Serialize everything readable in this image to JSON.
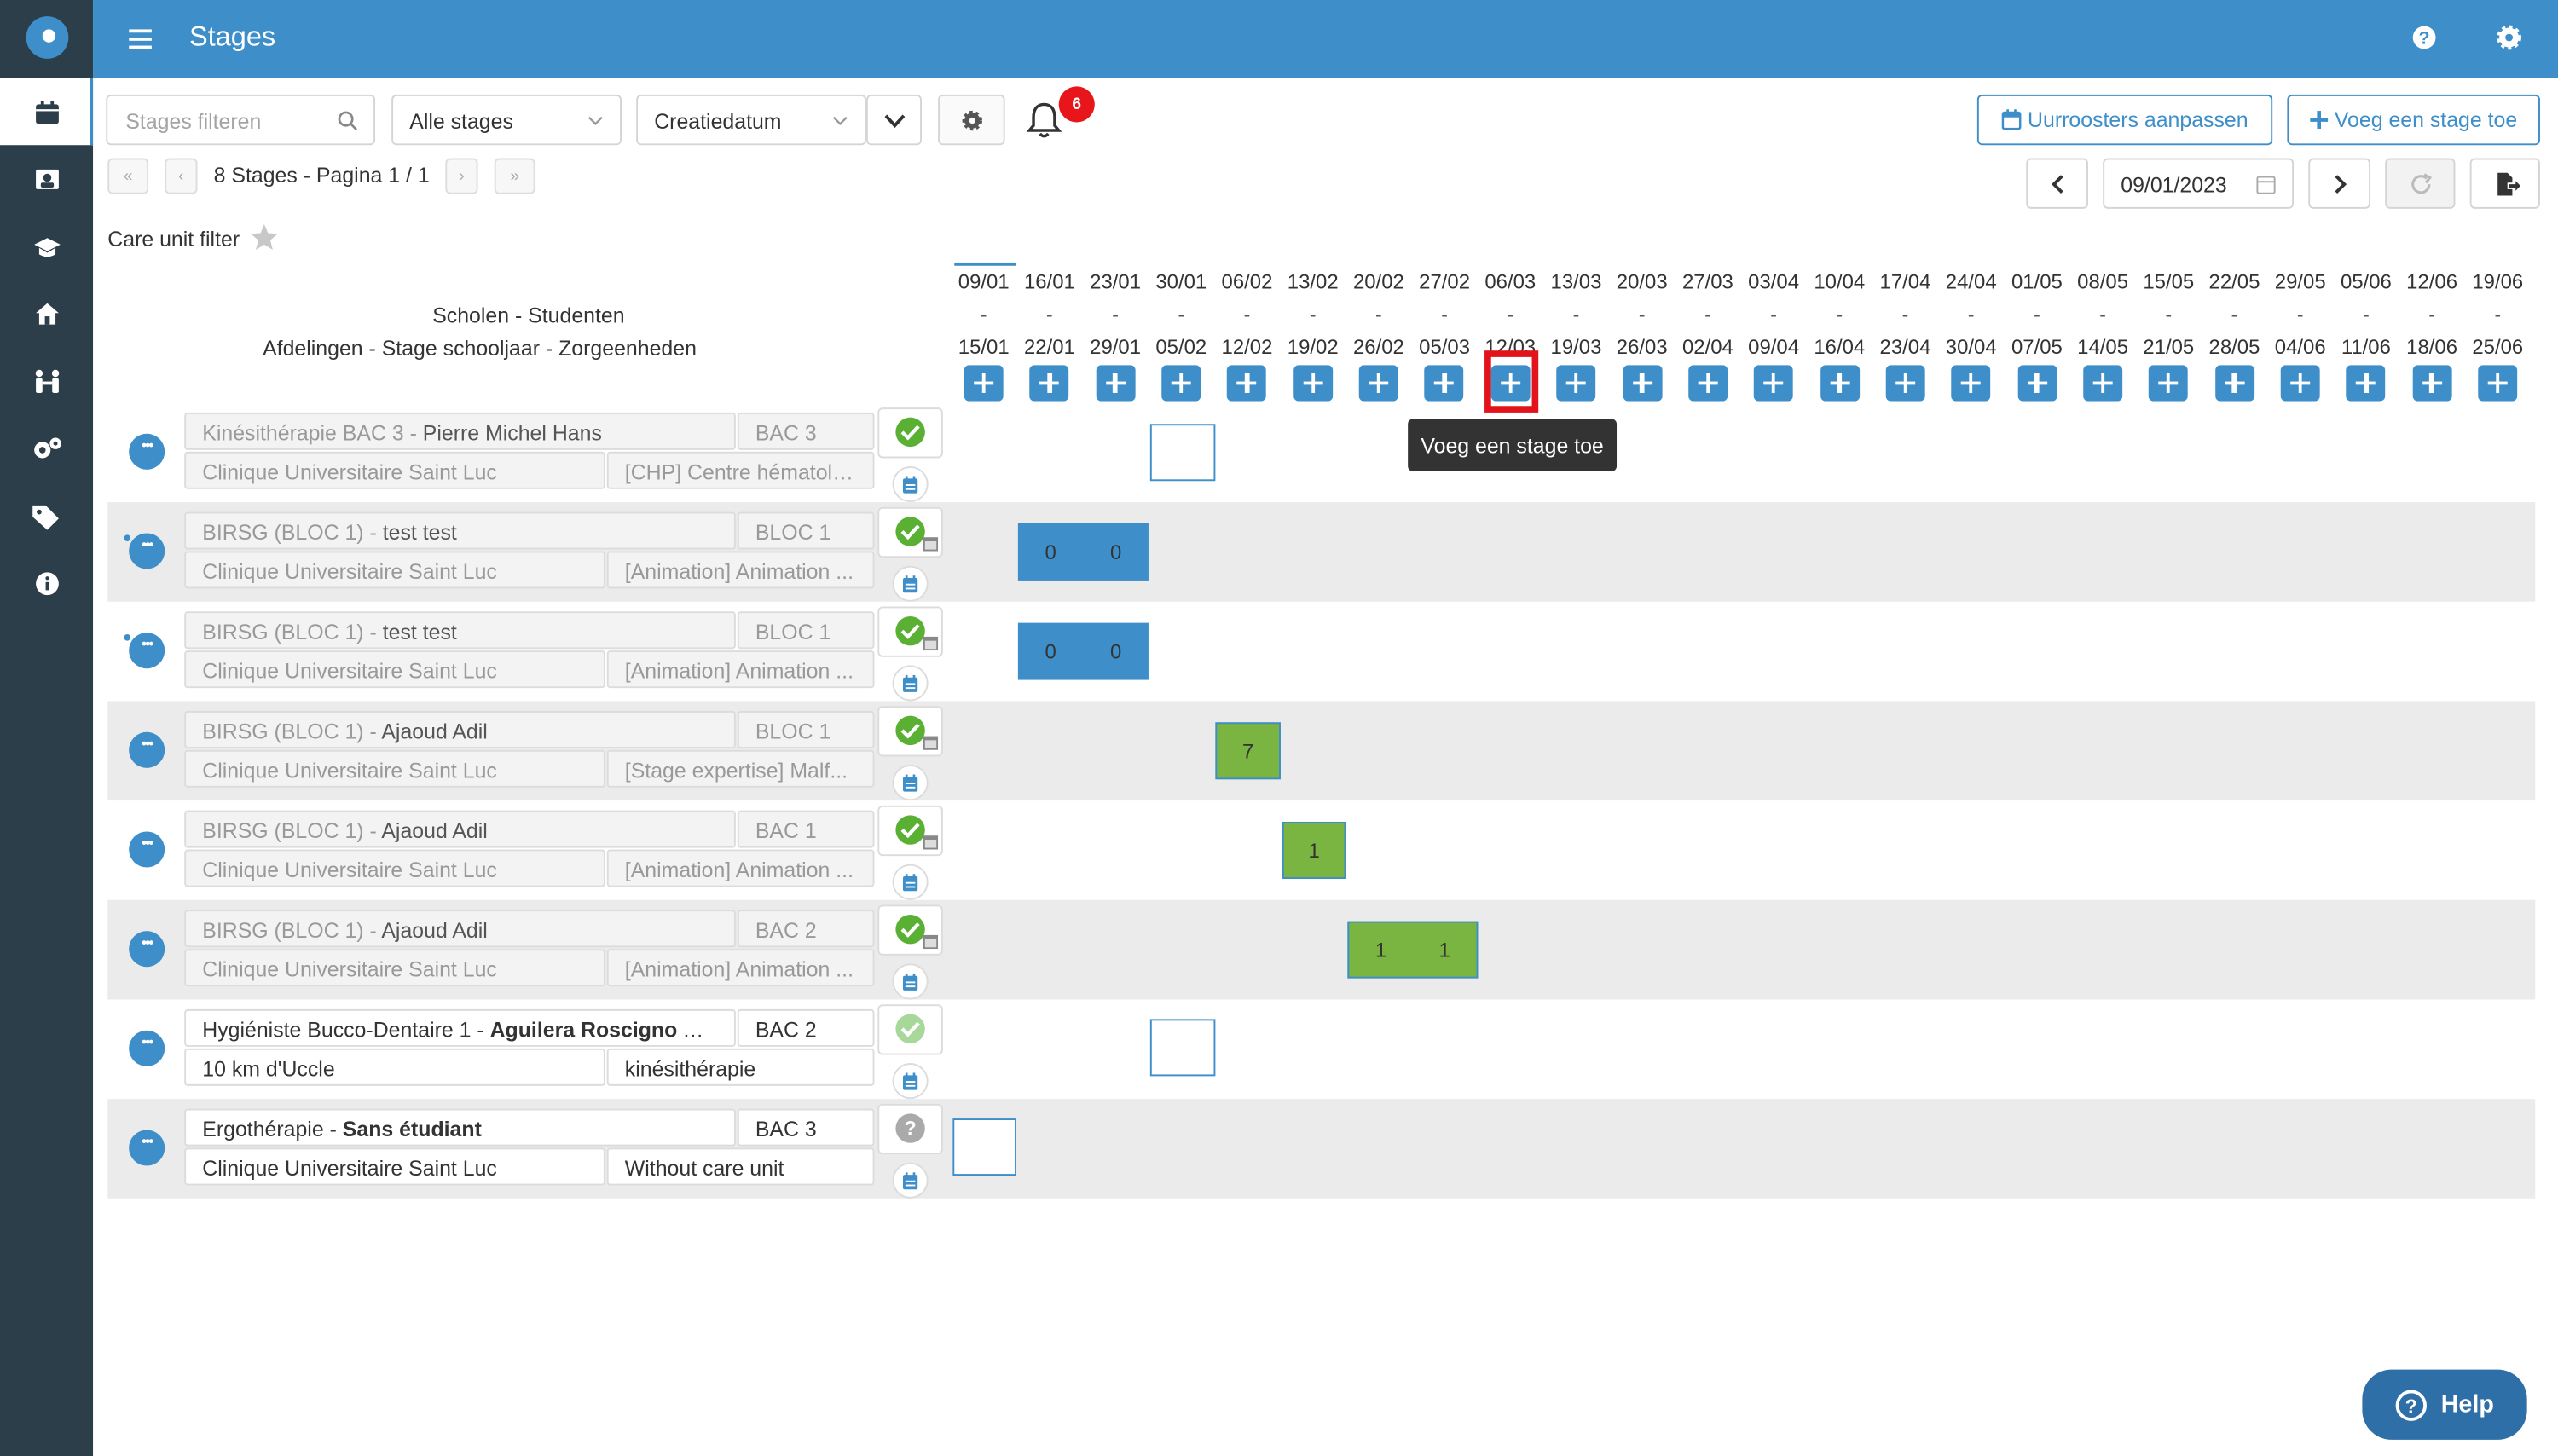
{
  "app": {
    "title": "Stages"
  },
  "sidebar": {
    "items": [
      {
        "icon": "calendar-icon",
        "active": true
      },
      {
        "icon": "student-icon"
      },
      {
        "icon": "graduation-cap-icon"
      },
      {
        "icon": "home-icon"
      },
      {
        "icon": "people-icon"
      },
      {
        "icon": "gears-icon"
      },
      {
        "icon": "tags-icon"
      },
      {
        "icon": "info-icon"
      }
    ]
  },
  "toolbar": {
    "search_placeholder": "Stages filteren",
    "filter_select": "Alle stages",
    "sort_select": "Creatiedatum",
    "notification_count": "6",
    "schedules_button": "Uurroosters aanpassen",
    "add_button": "Voeg een stage toe",
    "pagination": "8 Stages - Pagina 1 / 1",
    "date_value": "09/01/2023",
    "care_unit_filter": "Care unit filter"
  },
  "grid_header": {
    "line1": "Scholen - Studenten",
    "line2": "Afdelingen - Stage schooljaar - Zorgeenheden"
  },
  "weeks": [
    {
      "start": "09/01",
      "end": "15/01"
    },
    {
      "start": "16/01",
      "end": "22/01"
    },
    {
      "start": "23/01",
      "end": "29/01"
    },
    {
      "start": "30/01",
      "end": "05/02"
    },
    {
      "start": "06/02",
      "end": "12/02"
    },
    {
      "start": "13/02",
      "end": "19/02"
    },
    {
      "start": "20/02",
      "end": "26/02"
    },
    {
      "start": "27/02",
      "end": "05/03"
    },
    {
      "start": "06/03",
      "end": "12/03"
    },
    {
      "start": "13/03",
      "end": "19/03"
    },
    {
      "start": "20/03",
      "end": "26/03"
    },
    {
      "start": "27/03",
      "end": "02/04"
    },
    {
      "start": "03/04",
      "end": "09/04"
    },
    {
      "start": "10/04",
      "end": "16/04"
    },
    {
      "start": "17/04",
      "end": "23/04"
    },
    {
      "start": "24/04",
      "end": "30/04"
    },
    {
      "start": "01/05",
      "end": "07/05"
    },
    {
      "start": "08/05",
      "end": "14/05"
    },
    {
      "start": "15/05",
      "end": "21/05"
    },
    {
      "start": "22/05",
      "end": "28/05"
    },
    {
      "start": "29/05",
      "end": "04/06"
    },
    {
      "start": "05/06",
      "end": "11/06"
    },
    {
      "start": "12/06",
      "end": "18/06"
    },
    {
      "start": "19/06",
      "end": "25/06"
    }
  ],
  "tooltip": "Voeg een stage toe",
  "rows": [
    {
      "school": "Kinésithérapie BAC 3 - ",
      "student": "Pierre Michel Hans",
      "level": "BAC 3",
      "institution": "Clinique Universitaire Saint Luc",
      "unit": "[CHP] Centre hématolo...",
      "status": "green"
    },
    {
      "school": "BIRSG (BLOC 1) - ",
      "student": "test test",
      "level": "BLOC 1",
      "institution": "Clinique Universitaire Saint Luc",
      "unit": "[Animation] Animation ...",
      "status": "green",
      "bar": [
        "0",
        "0"
      ]
    },
    {
      "school": "BIRSG (BLOC 1) - ",
      "student": "test test",
      "level": "BLOC 1",
      "institution": "Clinique Universitaire Saint Luc",
      "unit": "[Animation] Animation ...",
      "status": "green",
      "bar": [
        "0",
        "0"
      ]
    },
    {
      "school": "BIRSG (BLOC 1) - ",
      "student": "Ajaoud Adil",
      "level": "BLOC 1",
      "institution": "Clinique Universitaire Saint Luc",
      "unit": "[Stage expertise] Malf...",
      "status": "green",
      "bar": [
        "7"
      ]
    },
    {
      "school": "BIRSG (BLOC 1) - ",
      "student": "Ajaoud Adil",
      "level": "BAC 1",
      "institution": "Clinique Universitaire Saint Luc",
      "unit": "[Animation] Animation ...",
      "status": "green",
      "bar": [
        "1"
      ]
    },
    {
      "school": "BIRSG (BLOC 1) - ",
      "student": "Ajaoud Adil",
      "level": "BAC 2",
      "institution": "Clinique Universitaire Saint Luc",
      "unit": "[Animation] Animation ...",
      "status": "green",
      "bar": [
        "1",
        "1"
      ]
    },
    {
      "school": "Hygiéniste Bucco-Dentaire 1 - ",
      "student": "Aguilera Roscigno Ana...",
      "level": "BAC 2",
      "institution": "10 km d'Uccle",
      "unit": "kinésithérapie",
      "status": "light"
    },
    {
      "school": "Ergothérapie - ",
      "student": "Sans étudiant",
      "level": "BAC 3",
      "institution": "Clinique Universitaire Saint Luc",
      "unit": "Without care unit",
      "status": "unknown"
    }
  ],
  "help": {
    "label": "Help"
  }
}
